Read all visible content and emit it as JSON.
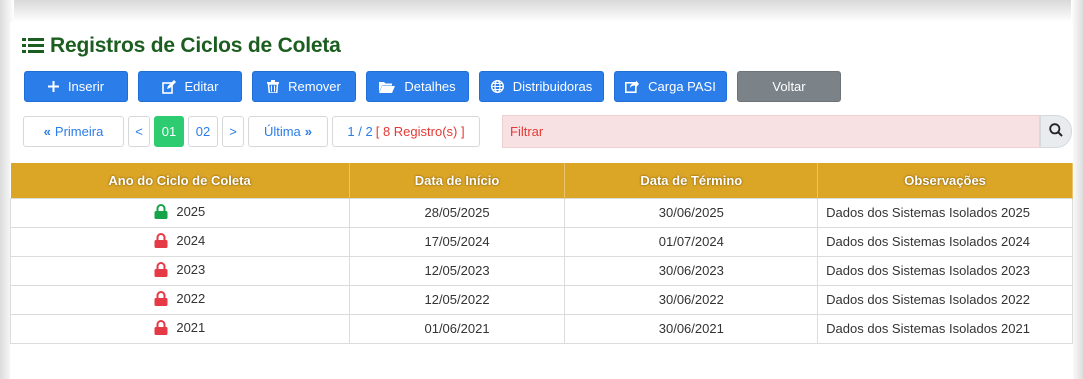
{
  "title": "Registros de Ciclos de Coleta",
  "toolbar": {
    "inserir": "Inserir",
    "editar": "Editar",
    "remover": "Remover",
    "detalhes": "Detalhes",
    "distribuidoras": "Distribuidoras",
    "carga_pasi": "Carga PASI",
    "voltar": "Voltar"
  },
  "pager": {
    "first": "Primeira",
    "prev": "<",
    "pages": [
      "01",
      "02"
    ],
    "next": ">",
    "last": "Última",
    "info": "1 / 2",
    "records": "[ 8 Registro(s) ]"
  },
  "filter": {
    "placeholder": "Filtrar"
  },
  "table": {
    "headers": [
      "Ano do Ciclo de Coleta",
      "Data de Início",
      "Data de Término",
      "Observações"
    ],
    "rows": [
      {
        "ano": "2025",
        "inicio": "28/05/2025",
        "termino": "30/06/2025",
        "obs": "Dados dos Sistemas Isolados 2025",
        "lock": "lock-open-icon"
      },
      {
        "ano": "2024",
        "inicio": "17/05/2024",
        "termino": "01/07/2024",
        "obs": "Dados dos Sistemas Isolados 2024",
        "lock": "lock-closed-icon"
      },
      {
        "ano": "2023",
        "inicio": "12/05/2023",
        "termino": "30/06/2023",
        "obs": "Dados dos Sistemas Isolados 2023",
        "lock": "lock-closed-icon"
      },
      {
        "ano": "2022",
        "inicio": "12/05/2022",
        "termino": "30/06/2022",
        "obs": "Dados dos Sistemas Isolados 2022",
        "lock": "lock-closed-icon"
      },
      {
        "ano": "2021",
        "inicio": "01/06/2021",
        "termino": "30/06/2021",
        "obs": "Dados dos Sistemas Isolados 2021",
        "lock": "lock-closed-icon"
      }
    ]
  },
  "colors": {
    "title": "#1b5e20",
    "primary_button": "#2b7de9",
    "voltar_button": "#7b8288",
    "active_page": "#2ecc71",
    "table_header": "#dba526",
    "lock_open": "#16a34a",
    "lock_closed": "#e53945",
    "filter_bg": "#f8e1e2"
  }
}
